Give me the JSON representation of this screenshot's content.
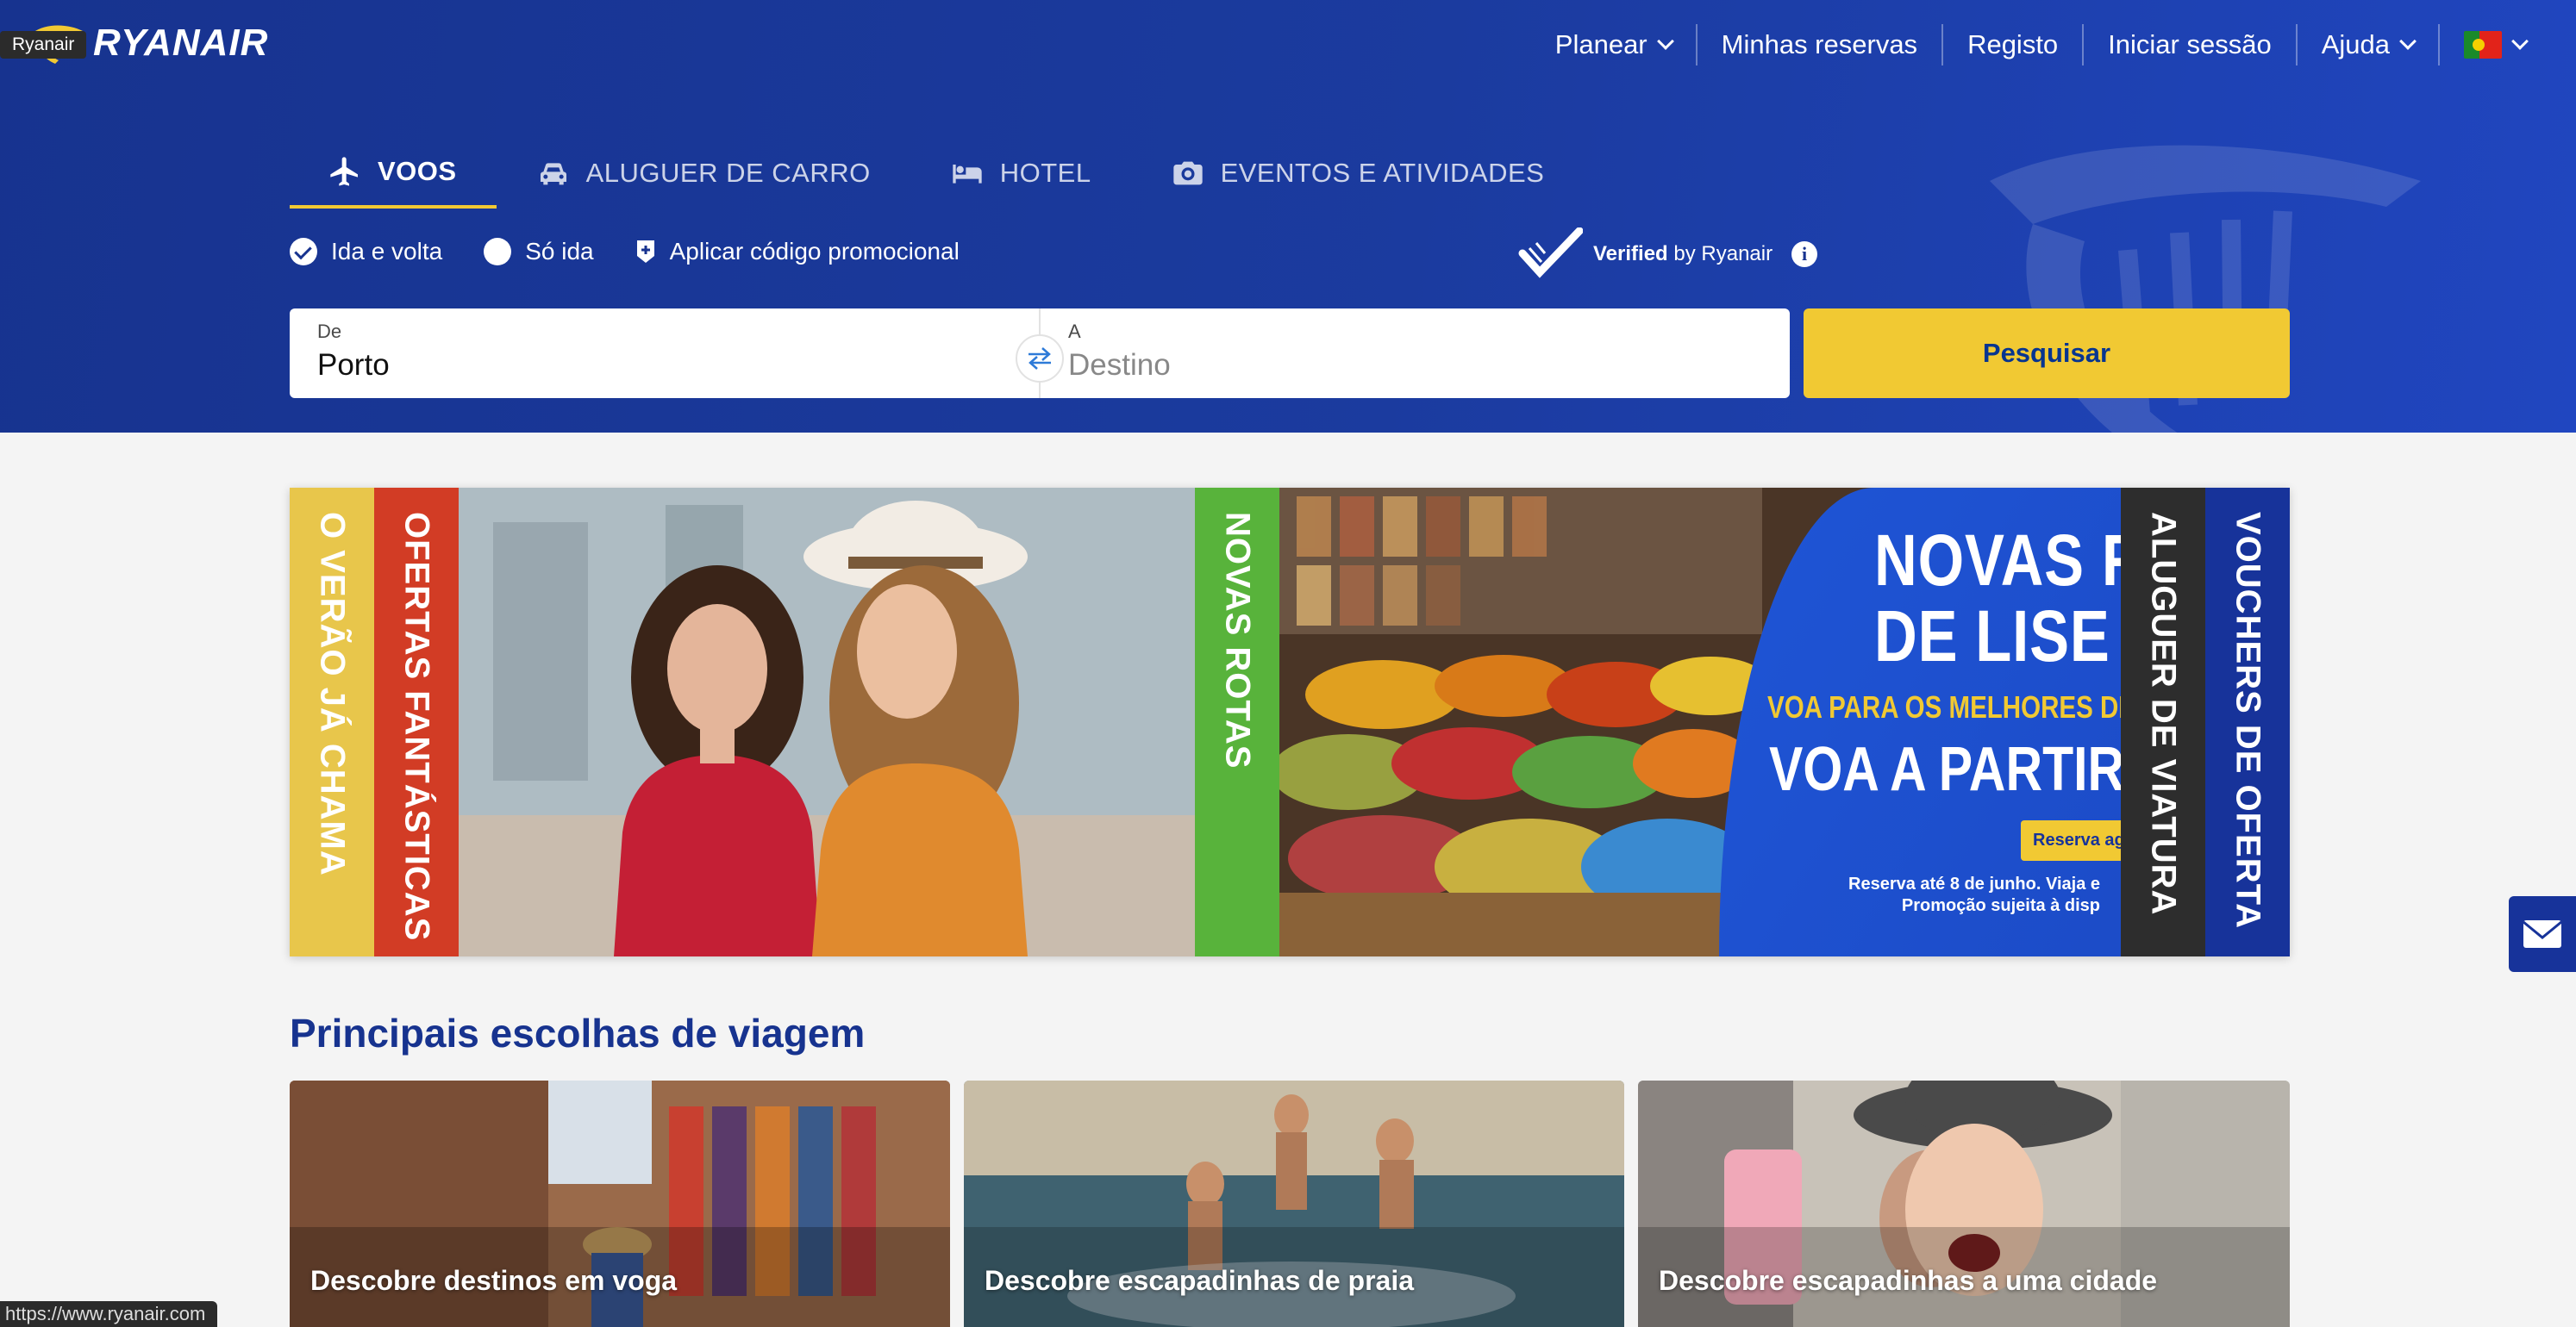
{
  "tooltip": "Ryanair",
  "brand": {
    "logo_text": "RYANAIR"
  },
  "topnav": {
    "items": [
      {
        "label": "Planear",
        "has_chevron": true
      },
      {
        "label": "Minhas reservas"
      },
      {
        "label": "Registo"
      },
      {
        "label": "Iniciar sessão"
      },
      {
        "label": "Ajuda",
        "has_chevron": true
      }
    ],
    "language_flag": "portugal-flag-icon"
  },
  "tabs": [
    {
      "label": "VOOS",
      "icon": "plane-icon",
      "active": true
    },
    {
      "label": "ALUGUER DE CARRO",
      "icon": "car-icon"
    },
    {
      "label": "HOTEL",
      "icon": "bed-icon"
    },
    {
      "label": "EVENTOS E ATIVIDADES",
      "icon": "camera-icon"
    }
  ],
  "trip_options": {
    "round_trip": "Ida e volta",
    "one_way": "Só ida",
    "promo_code": "Aplicar código promocional",
    "selected": "round_trip"
  },
  "verified": {
    "strong": "Verified",
    "rest": " by Ryanair"
  },
  "search": {
    "from_label": "De",
    "from_value": "Porto",
    "to_label": "A",
    "to_placeholder": "Destino",
    "button": "Pesquisar"
  },
  "banner": {
    "strips": [
      "O VERÃO JÁ CHAMA",
      "OFERTAS FANTÁSTICAS",
      "NOVAS ROTAS",
      "ALUGUER DE VIATURA",
      "VOUCHERS DE OFERTA"
    ],
    "promo_headline_1": "NOVAS R",
    "promo_headline_2": "DE LISE",
    "promo_sub": "VOA PARA OS MELHORES DE",
    "promo_big": "VOA A PARTIR D",
    "promo_button": "Reserva agora",
    "promo_small_1": "Reserva até 8 de junho. Viaja e",
    "promo_small_2": "Promoção sujeita à disp"
  },
  "picks": {
    "title": "Principais escolhas de viagem",
    "cards": [
      {
        "title": "Descobre destinos em voga"
      },
      {
        "title": "Descobre escapadinhas de praia"
      },
      {
        "title": "Descobre escapadinhas a uma cidade"
      }
    ]
  },
  "status_url": "https://www.ryanair.com",
  "colors": {
    "brand_navy": "#17338f",
    "accent_yellow": "#f1c933"
  }
}
